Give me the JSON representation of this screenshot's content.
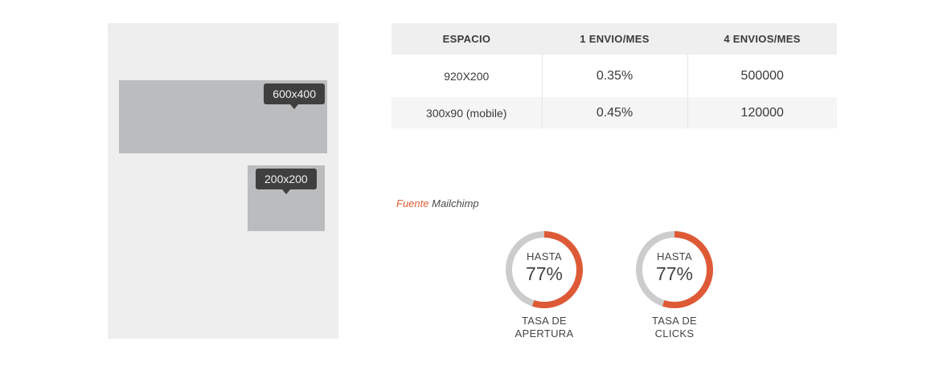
{
  "mockup": {
    "tooltip_large": "600x400",
    "tooltip_small": "200x200"
  },
  "pricing_table": {
    "headers": [
      "ESPACIO",
      "1 ENVIO/MES",
      "4 ENVIOS/MES"
    ],
    "rows": [
      [
        "920X200",
        "0.35%",
        "500000"
      ],
      [
        "300x90 (mobile)",
        "0.45%",
        "120000"
      ]
    ]
  },
  "source": {
    "label": "Fuente",
    "name": "Mailchimp"
  },
  "stats": [
    {
      "kicker": "HASTA",
      "value": "77%",
      "caption_line1": "TASA DE",
      "caption_line2": "APERTURA",
      "fill_fraction": 0.55
    },
    {
      "kicker": "HASTA",
      "value": "77%",
      "caption_line1": "TASA DE",
      "caption_line2": "CLICKS",
      "fill_fraction": 0.55
    }
  ],
  "colors": {
    "accent": "#de5a36",
    "track": "#cccccc",
    "panel": "#eeeeee",
    "banner": "#bbbcbd",
    "tooltip": "#3f3f3f"
  }
}
